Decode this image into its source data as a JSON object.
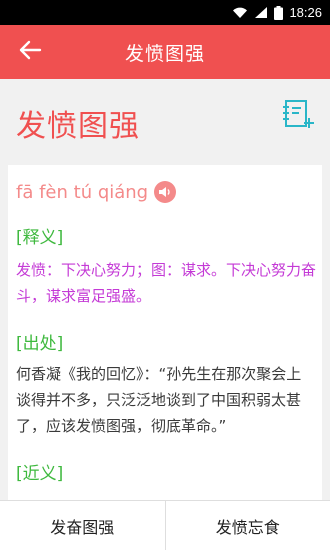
{
  "status_bar": {
    "time": "18:26"
  },
  "app_bar": {
    "title": "发愤图强"
  },
  "idiom": {
    "word": "发愤图强",
    "pinyin": "fā fèn tú qiáng"
  },
  "sections": {
    "meaning": {
      "label": "[释义]",
      "text": "发愤：下决心努力；图：谋求。下决心努力奋斗，谋求富足强盛。"
    },
    "source": {
      "label": "[出处]",
      "text": "何香凝《我的回忆》：“孙先生在那次聚会上谈得并不多，只泛泛地谈到了中国积弱太甚了，应该发愤图强，彻底革命。”"
    },
    "synonyms": {
      "label": "[近义]"
    }
  },
  "bottom_nav": {
    "prev": "发奋图强",
    "next": "发愤忘食"
  },
  "colors": {
    "accent": "#f05050",
    "pinyin": "#f48a8a",
    "label_green": "#3fb93f",
    "meaning_purple": "#c43ad6",
    "notes_icon": "#29b6c8"
  },
  "icons": {
    "back": "arrow-left-icon",
    "notes": "notes-add-icon",
    "speaker": "speaker-icon",
    "wifi": "wifi-icon",
    "signal": "signal-icon",
    "battery": "battery-icon"
  }
}
